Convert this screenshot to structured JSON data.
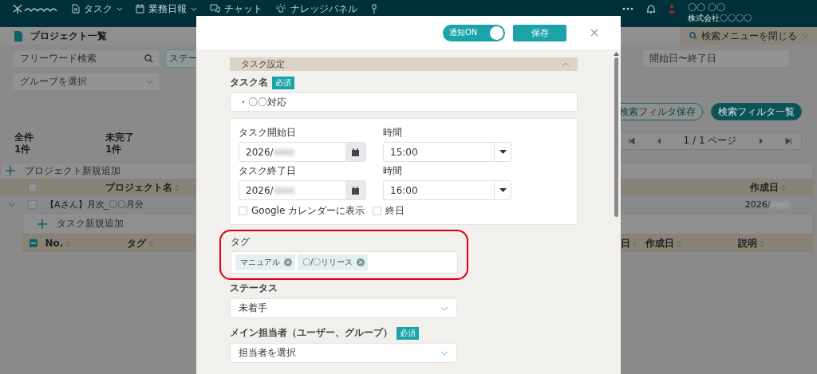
{
  "nav": {
    "items": [
      {
        "label": "タスク",
        "dropdown": true
      },
      {
        "label": "業務日報",
        "dropdown": true
      },
      {
        "label": "チャット",
        "dropdown": false
      },
      {
        "label": "ナレッジパネル",
        "dropdown": false
      }
    ],
    "user": {
      "name": "〇〇 〇〇",
      "company": "株式会社〇〇〇〇"
    }
  },
  "page": {
    "title": "プロジェクト一覧",
    "close_search": "検索メニューを閉じる"
  },
  "search": {
    "keyword_placeholder": "フリーワード検索",
    "status_placeholder": "ステー",
    "date_placeholder": "開始日〜終了日",
    "group_placeholder": "グループを選択",
    "buttons": [
      {
        "label": "検索フィルタ保存",
        "kind": "outline"
      },
      {
        "label": "検索フィルタ一覧",
        "kind": "filled"
      }
    ]
  },
  "stats": [
    {
      "label": "全件",
      "value": "1件"
    },
    {
      "label": "未完了",
      "value": "1件"
    }
  ],
  "pager": {
    "text": "1 / 1 ページ"
  },
  "table": {
    "add_project": "プロジェクト新規追加",
    "all_checked": false,
    "columns": [
      "プロジェクト名",
      "作成日"
    ],
    "rows": [
      {
        "name": "【Aさん】月次_〇〇月分",
        "created": "2026/",
        "expanded": true,
        "checked": false
      }
    ],
    "add_task": "タスク新規追加",
    "task_columns": [
      "No.",
      "タグ",
      "日",
      "作成日",
      "説明"
    ]
  },
  "modal": {
    "notify": {
      "label": "通知ON",
      "on": true
    },
    "save": "保存",
    "section": {
      "title": "タスク設定",
      "expanded": true
    },
    "task_name": {
      "label": "タスク名",
      "required": "必須",
      "value": "・〇〇対応"
    },
    "schedule": [
      {
        "label": "タスク開始日",
        "date": "2026/",
        "time_label": "時間",
        "time": "15:00"
      },
      {
        "label": "タスク終了日",
        "date": "2026/",
        "time_label": "時間",
        "time": "16:00"
      }
    ],
    "options": [
      {
        "label": "Google カレンダーに表示",
        "checked": false
      },
      {
        "label": "終日",
        "checked": false
      }
    ],
    "tags": {
      "label": "タグ",
      "highlighted": true,
      "items": [
        "マニュアル",
        "〇/〇リリース"
      ]
    },
    "status": {
      "label": "ステータス",
      "value": "未着手"
    },
    "assignee": {
      "label": "メイン担当者（ユーザー、グループ）",
      "required": "必須",
      "placeholder": "担当者を選択"
    }
  }
}
